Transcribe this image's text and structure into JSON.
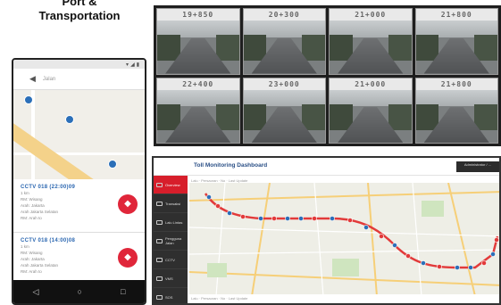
{
  "heading": {
    "line1": "Port &",
    "line2": "Transportation"
  },
  "cctv": {
    "cameras": [
      {
        "label": "19+850"
      },
      {
        "label": "20+300"
      },
      {
        "label": "21+000"
      },
      {
        "label": "21+800"
      },
      {
        "label": "22+400"
      },
      {
        "label": "23+000"
      },
      {
        "label": "21+000"
      },
      {
        "label": "21+800"
      }
    ]
  },
  "phone": {
    "search_placeholder": "Jalan",
    "cards": [
      {
        "title": "CCTV 018 (22:00)09",
        "lines": [
          "1 km",
          "RM: Wisang",
          "Arah: Jakarta",
          "Arah Jakarta Selatan",
          "RM: Arah to"
        ]
      },
      {
        "title": "CCTV 018 (14:00)08",
        "lines": [
          "1 km",
          "RM: Wisang",
          "Arah: Jakarta",
          "Arah Jakarta Selatan",
          "RM: Arah to"
        ]
      }
    ]
  },
  "dashboard": {
    "title": "Toll Monitoring Dashboard",
    "header_button": "Administrator / ...",
    "filter_top": "Lalu  ·  Persaoran  ·  No  ·  Last Update",
    "filter_bottom": "Lalu  ·  Persaoran  ·  No  ·  Last Update",
    "menu": [
      {
        "label": "Overview",
        "active": true
      },
      {
        "label": "Transaksi",
        "active": false
      },
      {
        "label": "Lalu Lintas",
        "active": false
      },
      {
        "label": "Pengguna Jalan",
        "active": false
      },
      {
        "label": "CCTV",
        "active": false
      },
      {
        "label": "VMS",
        "active": false
      },
      {
        "label": "SOS",
        "active": false
      }
    ]
  },
  "colors": {
    "accent_red": "#d71e2b",
    "route_red": "#e23a3a",
    "marker_blue": "#2b6fb8",
    "sidebar_dark": "#2f2f2f",
    "title_blue": "#2a4f86"
  }
}
